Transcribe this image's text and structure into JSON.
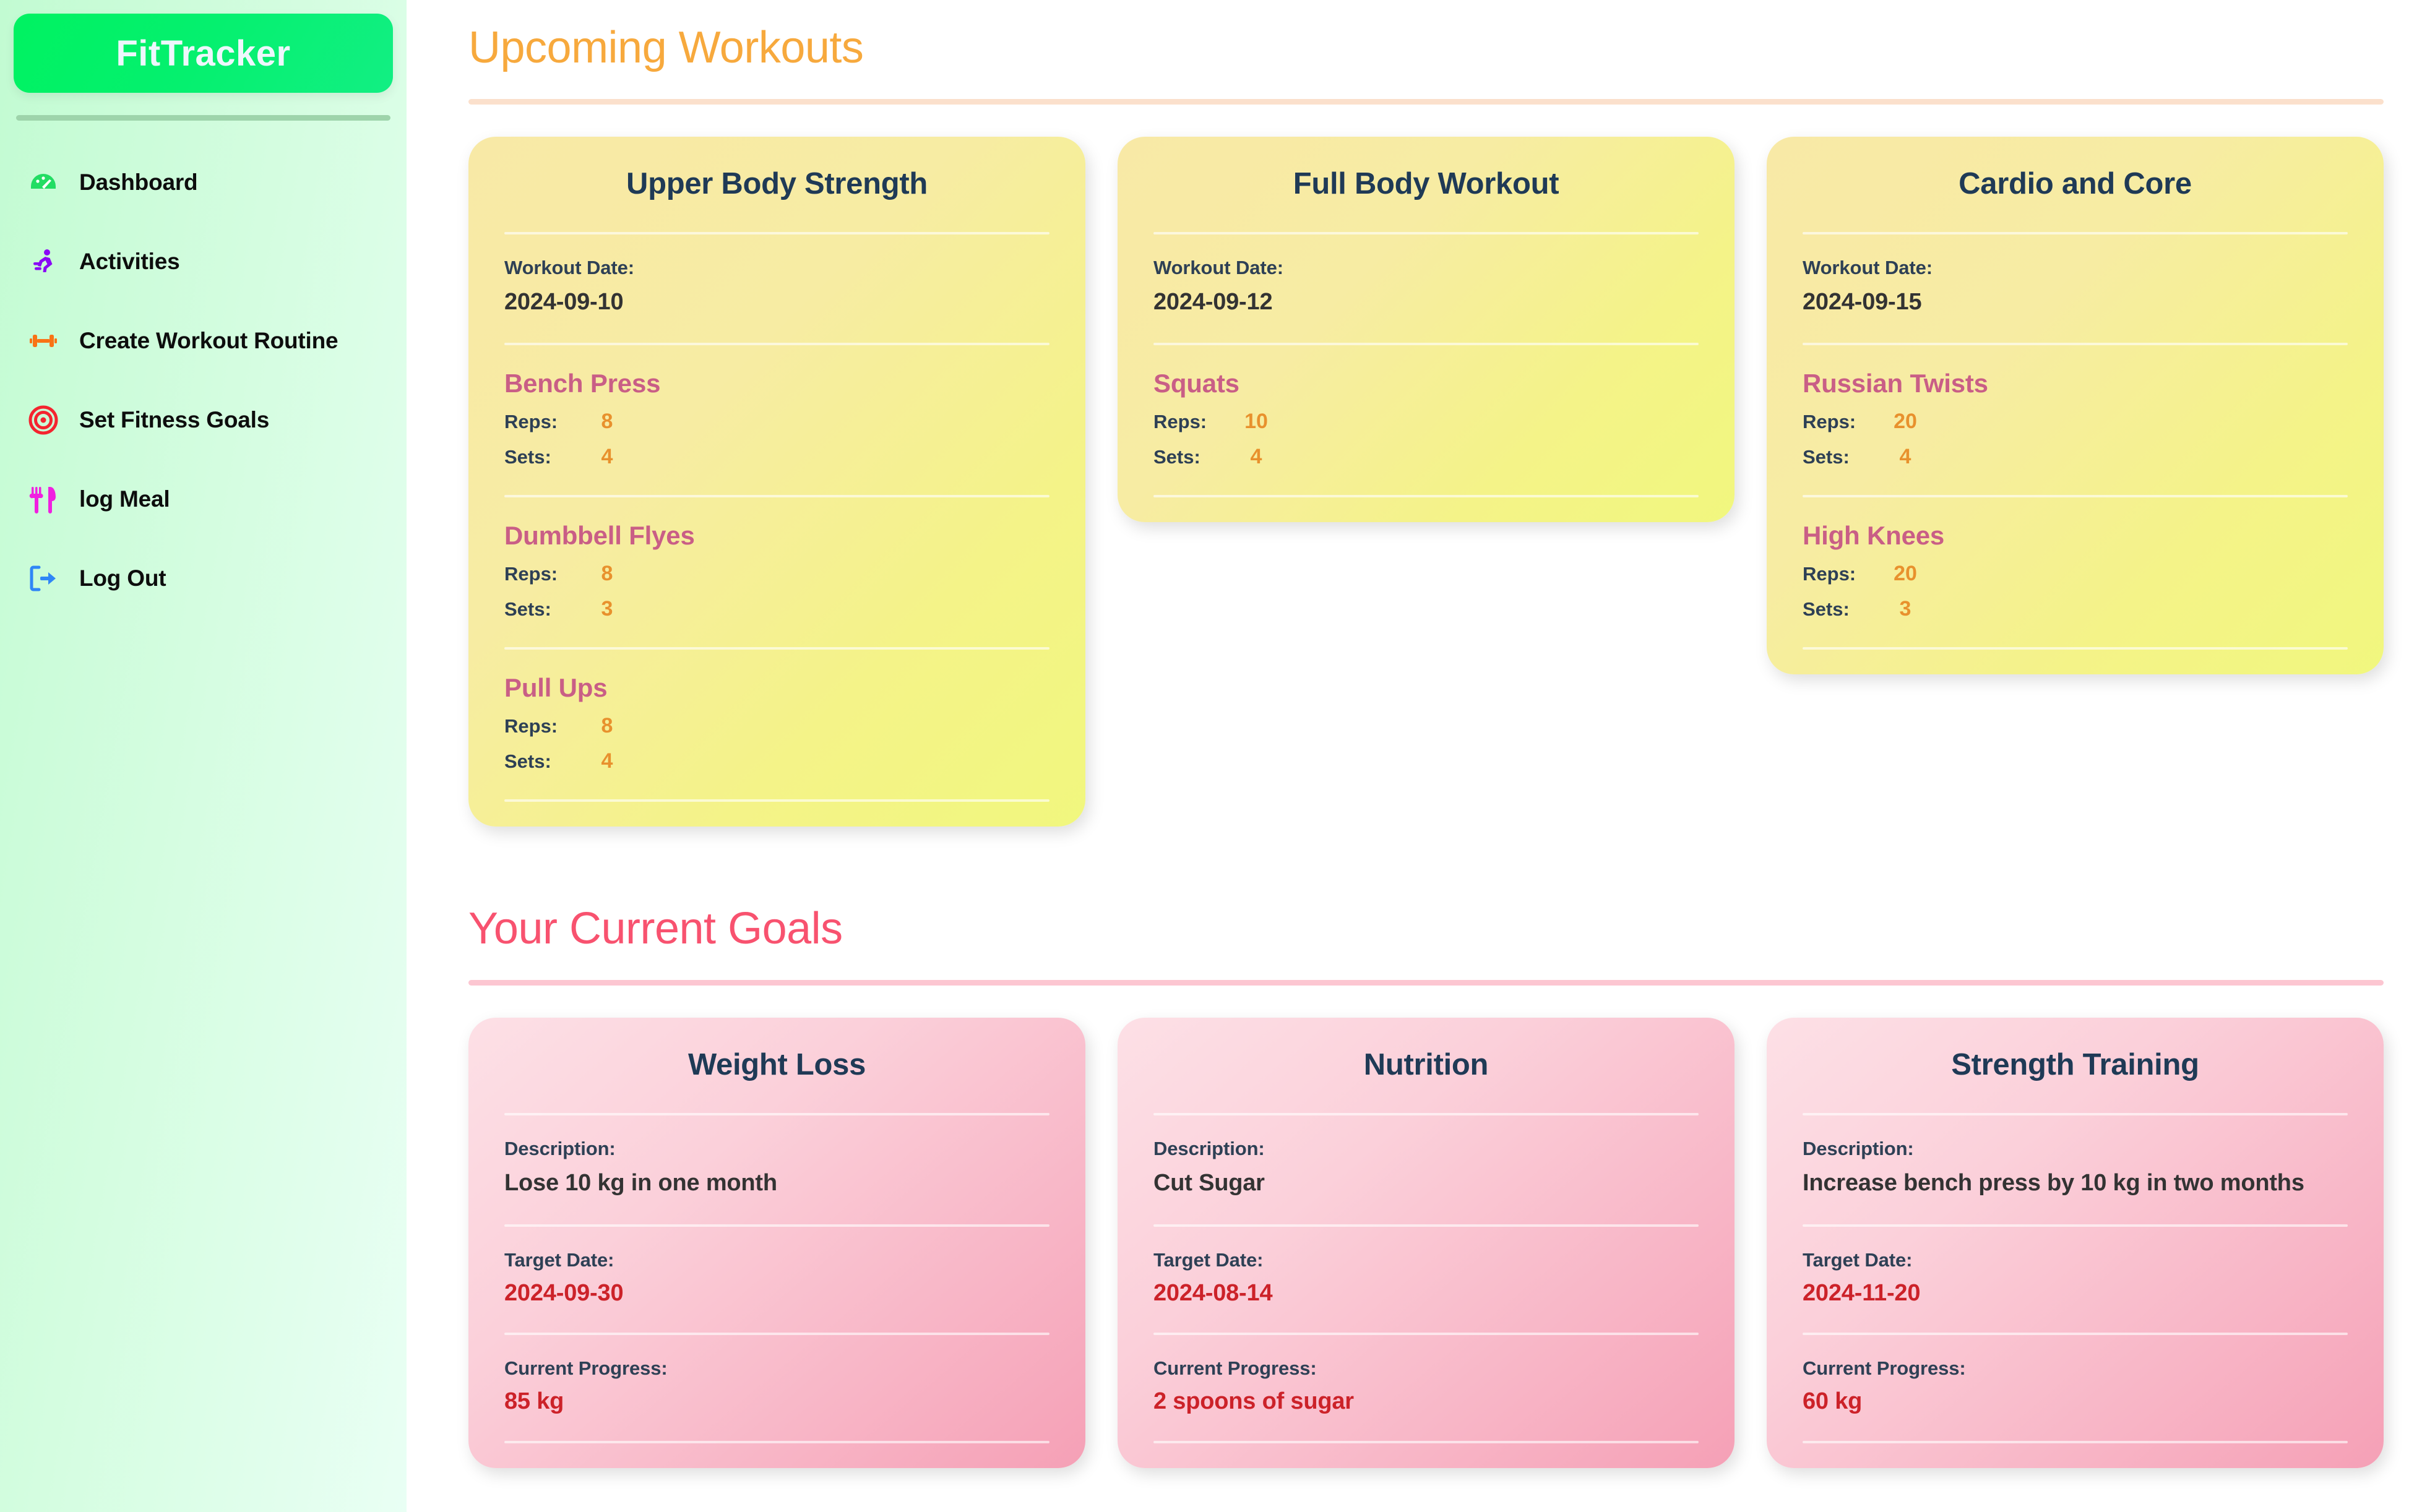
{
  "sidebar": {
    "brand": "FitTracker",
    "items": [
      {
        "label": "Dashboard",
        "icon": "speedometer-icon"
      },
      {
        "label": "Activities",
        "icon": "running-person-icon"
      },
      {
        "label": "Create Workout Routine",
        "icon": "dumbbell-icon"
      },
      {
        "label": "Set Fitness Goals",
        "icon": "target-icon"
      },
      {
        "label": "log Meal",
        "icon": "fork-knife-icon"
      },
      {
        "label": "Log Out",
        "icon": "logout-arrow-icon"
      }
    ]
  },
  "workouts_section": {
    "heading": "Upcoming Workouts",
    "date_label": "Workout Date:",
    "reps_label": "Reps:",
    "sets_label": "Sets:",
    "cards": [
      {
        "title": "Upper Body Strength",
        "date": "2024-09-10",
        "exercises": [
          {
            "name": "Bench Press",
            "reps": "8",
            "sets": "4"
          },
          {
            "name": "Dumbbell Flyes",
            "reps": "8",
            "sets": "3"
          },
          {
            "name": "Pull Ups",
            "reps": "8",
            "sets": "4"
          }
        ]
      },
      {
        "title": "Full Body Workout",
        "date": "2024-09-12",
        "exercises": [
          {
            "name": "Squats",
            "reps": "10",
            "sets": "4"
          }
        ]
      },
      {
        "title": "Cardio and Core",
        "date": "2024-09-15",
        "exercises": [
          {
            "name": "Russian Twists",
            "reps": "20",
            "sets": "4"
          },
          {
            "name": "High Knees",
            "reps": "20",
            "sets": "3"
          }
        ]
      }
    ]
  },
  "goals_section": {
    "heading": "Your Current Goals",
    "description_label": "Description:",
    "target_date_label": "Target Date:",
    "current_progress_label": "Current Progress:",
    "cards": [
      {
        "title": "Weight Loss",
        "description": "Lose 10 kg in one month",
        "target_date": "2024-09-30",
        "current_progress": "85 kg"
      },
      {
        "title": "Nutrition",
        "description": "Cut Sugar",
        "target_date": "2024-08-14",
        "current_progress": "2 spoons of sugar"
      },
      {
        "title": "Strength Training",
        "description": "Increase bench press by 10 kg in two months",
        "target_date": "2024-11-20",
        "current_progress": "60 kg"
      }
    ]
  },
  "colors": {
    "brand_green": "#00f261",
    "workouts_heading": "#f7a93d",
    "goals_heading": "#f8526f",
    "exercise_name": "#c95e86",
    "stat_value": "#e8912d",
    "date_red": "#cc2229",
    "card_title": "#1f3a56"
  }
}
